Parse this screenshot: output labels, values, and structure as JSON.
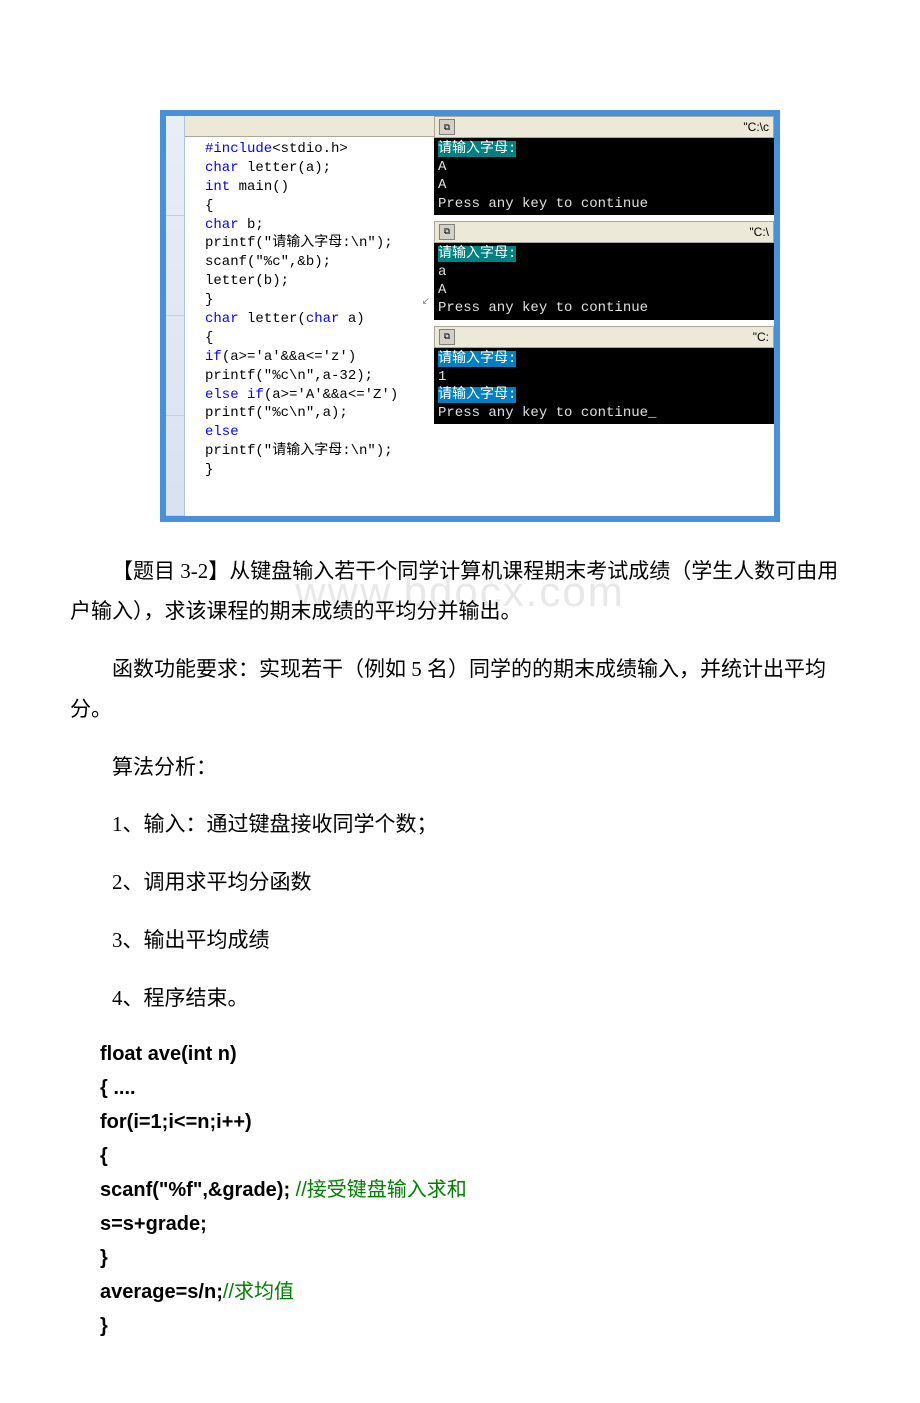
{
  "code_editor": {
    "lines": [
      {
        "segments": [
          {
            "t": "#include",
            "c": "kw-blue"
          },
          {
            "t": "<stdio.h>",
            "c": "normal"
          }
        ]
      },
      {
        "segments": [
          {
            "t": "char",
            "c": "kw-blue"
          },
          {
            "t": " letter(a);",
            "c": "normal"
          }
        ]
      },
      {
        "segments": [
          {
            "t": "int",
            "c": "kw-blue"
          },
          {
            "t": " main()",
            "c": "normal"
          }
        ]
      },
      {
        "segments": [
          {
            "t": "{",
            "c": "normal"
          }
        ]
      },
      {
        "segments": [
          {
            "t": "char",
            "c": "kw-blue"
          },
          {
            "t": " b;",
            "c": "normal"
          }
        ]
      },
      {
        "segments": [
          {
            "t": "printf(\"请输入字母:\\n\");",
            "c": "normal"
          }
        ]
      },
      {
        "segments": [
          {
            "t": "scanf(\"%c\",&b);",
            "c": "normal"
          }
        ]
      },
      {
        "segments": [
          {
            "t": "letter(b);",
            "c": "normal"
          }
        ]
      },
      {
        "segments": [
          {
            "t": "}",
            "c": "normal"
          }
        ]
      },
      {
        "segments": [
          {
            "t": "char",
            "c": "kw-blue"
          },
          {
            "t": " letter(",
            "c": "normal"
          },
          {
            "t": "char",
            "c": "kw-blue"
          },
          {
            "t": " a)",
            "c": "normal"
          }
        ]
      },
      {
        "segments": [
          {
            "t": "{",
            "c": "normal"
          }
        ]
      },
      {
        "segments": [
          {
            "t": "if",
            "c": "kw-blue"
          },
          {
            "t": "(a>='a'&&a<='z')",
            "c": "normal"
          }
        ]
      },
      {
        "segments": [
          {
            "t": "printf(\"%c\\n\",a-32);",
            "c": "normal"
          }
        ]
      },
      {
        "segments": [
          {
            "t": "else if",
            "c": "kw-blue"
          },
          {
            "t": "(a>='A'&&a<='Z')",
            "c": "normal"
          }
        ]
      },
      {
        "segments": [
          {
            "t": "printf(\"%c\\n\",a);",
            "c": "normal"
          }
        ]
      },
      {
        "segments": [
          {
            "t": "else",
            "c": "kw-blue"
          }
        ]
      },
      {
        "segments": [
          {
            "t": "printf(\"请输入字母:\\n\");",
            "c": "normal"
          }
        ]
      },
      {
        "segments": [
          {
            "t": "}",
            "c": "normal"
          }
        ]
      }
    ]
  },
  "consoles": [
    {
      "title_path": "\"C:\\c",
      "lines": [
        {
          "t": "请输入字母:",
          "hl": "hl"
        },
        {
          "t": "A"
        },
        {
          "t": "A"
        },
        {
          "t": "Press any key to continue"
        }
      ]
    },
    {
      "title_path": "\"C:\\",
      "lines": [
        {
          "t": "请输入字母:",
          "hl": "hl"
        },
        {
          "t": "a"
        },
        {
          "t": "A"
        },
        {
          "t": "Press any key to continue"
        }
      ]
    },
    {
      "title_path": "\"C:",
      "lines": [
        {
          "t": "请输入字母:",
          "hl": "hl2"
        },
        {
          "t": "1"
        },
        {
          "t": "请输入字母:",
          "hl": "hl2"
        },
        {
          "t": "Press any key to continue_"
        }
      ]
    }
  ],
  "para1": "【题目 3-2】从键盘输入若干个同学计算机课程期末考试成绩（学生人数可由用户输入），求该课程的期末成绩的平均分并输出。",
  "watermark": "www.bdocx.com",
  "para2": "函数功能要求：实现若干（例如 5 名）同学的的期末成绩输入，并统计出平均分。",
  "para3": "算法分析：",
  "list1": "1、输入：通过键盘接收同学个数；",
  "list2": "2、调用求平均分函数",
  "list3": "3、输出平均成绩",
  "list4": "4、程序结束。",
  "snippet": {
    "l1": "float  ave(int  n)",
    "l2": "{   ....",
    "l3": "  for(i=1;i<=n;i++)",
    "l4": "  {",
    "l5a": "    scanf(\"%f\",&grade); ",
    "l5b": "//接受键盘输入求和",
    "l6": "    s=s+grade;",
    "l7": "  }",
    "l8a": "  average=s/n;",
    "l8b": "//求均值",
    "l9": "}"
  }
}
